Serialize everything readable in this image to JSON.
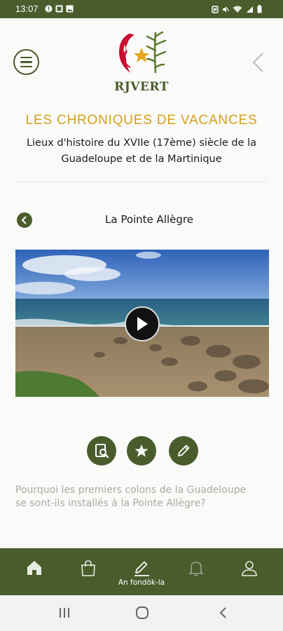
{
  "status_bar": {
    "time": "13:07",
    "left_icons": [
      "alert-icon",
      "photo-icon",
      "image-icon"
    ],
    "right_icons": [
      "nfc-icon",
      "mute-icon",
      "wifi-icon",
      "signal-icon",
      "battery-icon"
    ]
  },
  "header": {
    "logo_text": "RJVERT",
    "menu_icon": "menu-icon",
    "back_icon": "chevron-left-icon"
  },
  "section": {
    "title": "LES CHRONIQUES DE VACANCES",
    "subtitle": "Lieux d'histoire du XVIIe (17ème) siècle de la Guadeloupe et de la Martinique"
  },
  "place": {
    "title": "La Pointe Allègre"
  },
  "video": {
    "play_icon": "play-icon"
  },
  "actions": [
    {
      "icon": "document-search-icon"
    },
    {
      "icon": "star-icon"
    },
    {
      "icon": "pencil-icon"
    }
  ],
  "question": "Pourquoi les premiers colons de la Guadeloupe se sont-ils installés à la Pointe Allègre?",
  "bottom_nav": [
    {
      "icon": "home-icon",
      "label": ""
    },
    {
      "icon": "shopping-bag-icon",
      "label": ""
    },
    {
      "icon": "pencil-icon",
      "label": "An fondòk-la",
      "active": true
    },
    {
      "icon": "bell-icon",
      "label": ""
    },
    {
      "icon": "user-icon",
      "label": ""
    }
  ],
  "android_nav": [
    "recents-icon",
    "home-circle-icon",
    "back-icon"
  ],
  "colors": {
    "brand_green": "#4a5c2c",
    "title_gold": "#d4a017",
    "question_grey": "#a9a9a4"
  }
}
